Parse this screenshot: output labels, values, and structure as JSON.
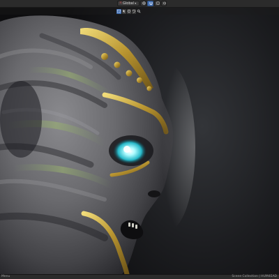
{
  "header": {
    "orientation_icon": "axes-orientation-icon",
    "orientation_label": "Global",
    "pivot_icon": "pivot-point-icon",
    "snap_icon": "snap-magnet-icon",
    "snap_increment_icon": "snap-increment-icon",
    "proportional_icon": "proportional-editing-icon",
    "visibility_icon": "visibility-dropdown-icon"
  },
  "viewport_toolbar": {
    "tools": [
      "select-box-icon",
      "cursor-icon",
      "circle-select-icon",
      "lasso-icon"
    ],
    "search_icon": "search-icon"
  },
  "statusbar": {
    "left_text": "Menu",
    "right_text": "Scene Collection | HUM4EAD"
  },
  "colors": {
    "header_bg": "#2b2b2b",
    "active_blue": "#4772b3",
    "skin": "#6b6b6f",
    "gold_trim": "#c9a93a",
    "eye_glow": "#7ff3ff"
  }
}
